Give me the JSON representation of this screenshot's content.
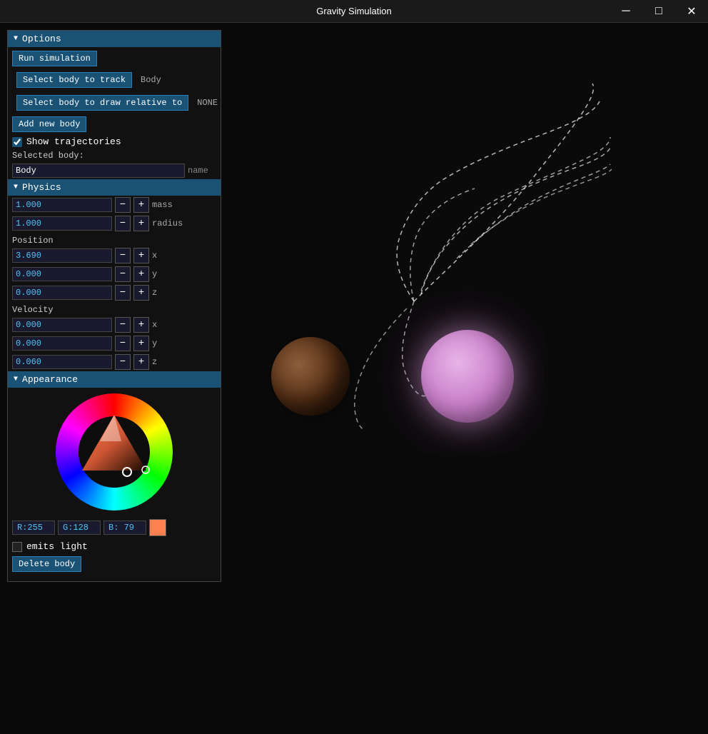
{
  "titleBar": {
    "title": "Gravity Simulation",
    "minimize": "─",
    "maximize": "□",
    "close": "✕"
  },
  "panel": {
    "options": {
      "header": "Options",
      "runSimulation": "Run simulation",
      "selectBodyToTrack": "Select body to track",
      "trackValue": "Body",
      "selectBodyDrawRelative": "Select body to draw relative to",
      "drawRelativeValue": "NONE",
      "addNewBody": "Add new body",
      "showTrajectories": "Show trajectories",
      "selectedBodyLabel": "Selected body:",
      "bodyName": "Body",
      "nameLabel": "name"
    },
    "physics": {
      "header": "Physics",
      "mass": "1.000",
      "massLabel": "mass",
      "radius": "1.000",
      "radiusLabel": "radius",
      "positionLabel": "Position",
      "posX": "3.690",
      "posY": "0.000",
      "posZ": "0.000",
      "velocityLabel": "Velocity",
      "velX": "0.000",
      "velY": "0.000",
      "velZ": "0.060"
    },
    "appearance": {
      "header": "Appearance",
      "r": "R:255",
      "g": "G:128",
      "b": "B: 79",
      "emitsLight": "emits light",
      "deleteBody": "Delete body"
    }
  }
}
